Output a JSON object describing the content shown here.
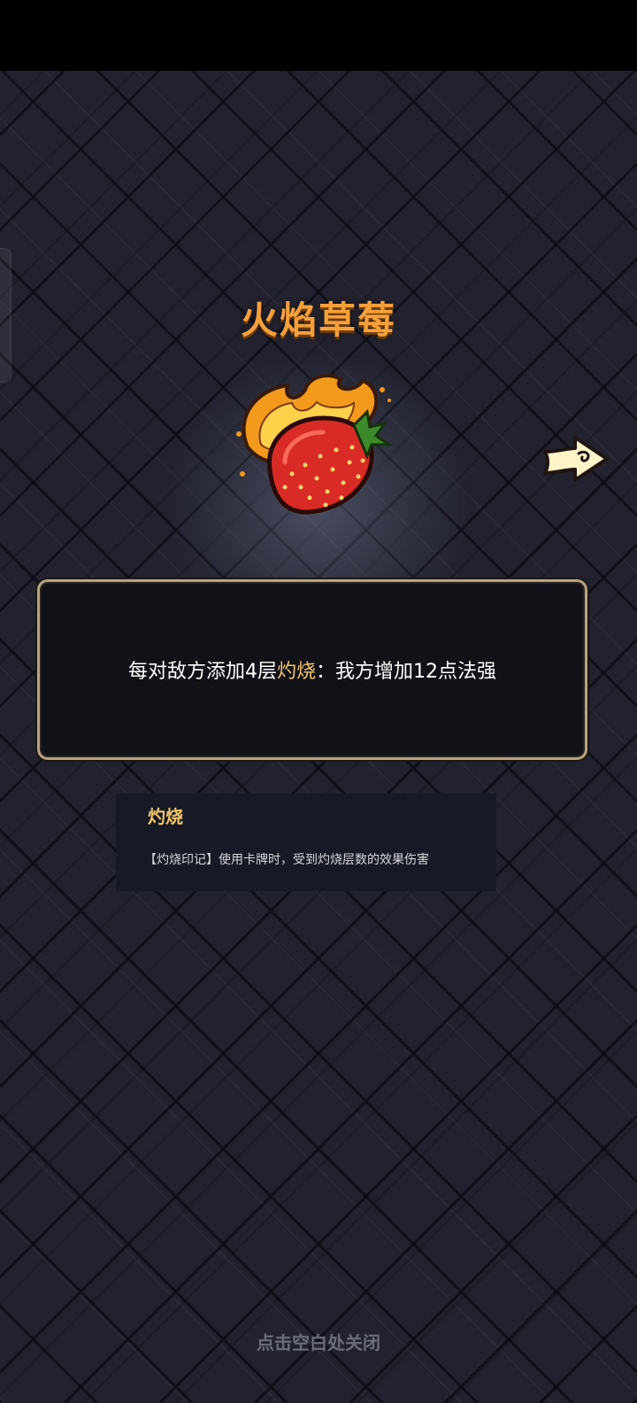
{
  "item": {
    "name": "火焰草莓",
    "icon": "flame-strawberry-icon"
  },
  "navigation": {
    "next_icon": "right-arrow-icon"
  },
  "description": {
    "prefix": "每对敌方添加4层",
    "keyword": "灼烧",
    "suffix": "：我方增加12点法强"
  },
  "keyword_tooltip": {
    "title": "灼烧",
    "text": "【灼烧印记】使用卡牌时，受到灼烧层数的效果伤害"
  },
  "close_hint": "点击空白处关闭",
  "colors": {
    "title": "#f6a03a",
    "keyword": "#f2c56a",
    "panel_border": "#b7a383",
    "background": "#22222f"
  }
}
